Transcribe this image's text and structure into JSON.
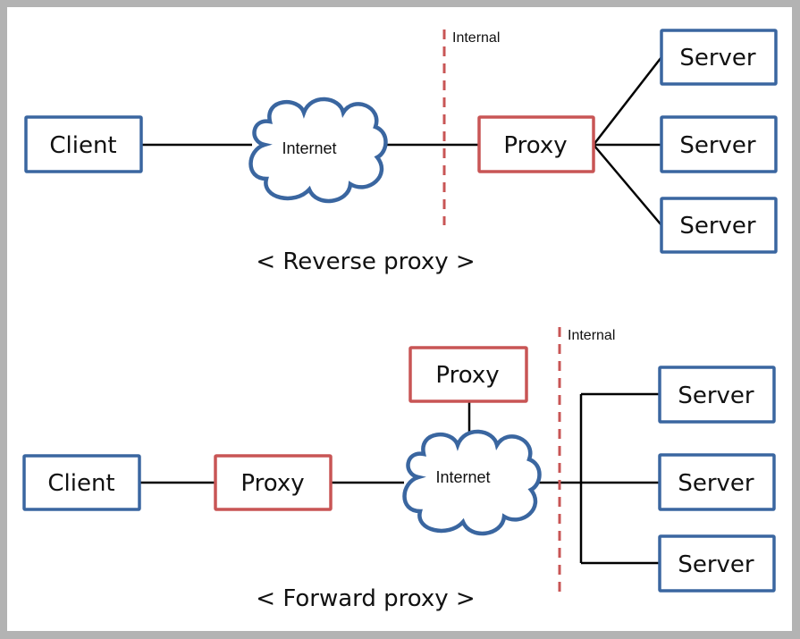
{
  "colors": {
    "client_server_border": "#3a66a0",
    "proxy_border": "#c85555",
    "cloud_stroke": "#3a66a0",
    "boundary_line": "#c85555",
    "connector": "#000000",
    "frame": "#b3b3b3"
  },
  "reverse": {
    "caption": "< Reverse proxy >",
    "client": "Client",
    "internet": "Internet",
    "internal": "Internal",
    "proxy": "Proxy",
    "servers": [
      "Server",
      "Server",
      "Server"
    ]
  },
  "forward": {
    "caption": "< Forward proxy >",
    "client": "Client",
    "client_proxy": "Proxy",
    "internet": "Internet",
    "side_proxy": "Proxy",
    "internal": "Internal",
    "servers": [
      "Server",
      "Server",
      "Server"
    ]
  }
}
